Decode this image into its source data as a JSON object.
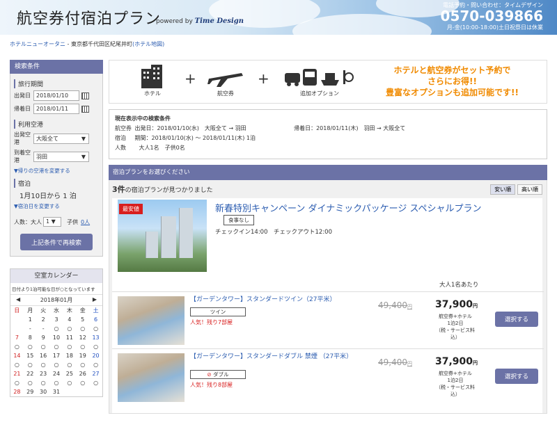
{
  "header": {
    "title": "航空券付宿泊プラン",
    "powered_by": "powered by",
    "brand": "Time Design",
    "contact_label": "電話予約・問い合わせ：タイムデザイン",
    "phone": "0570-039866",
    "hours": "月-金(10:00-18:00)土日祝祭日は休業"
  },
  "breadcrumb": {
    "hotel": "ホテルニューオータニ",
    "address": " - 東京都千代田区紀尾井町",
    "map_link": "(ホテル地図)"
  },
  "sidebar": {
    "title": "検索条件",
    "travel_period": "旅行期間",
    "depart_label": "出発日",
    "depart_value": "2018/01/10",
    "return_label": "帰着日",
    "return_value": "2018/01/11",
    "airport_title": "利用空港",
    "from_label": "出発空港",
    "from_value": "大阪全て",
    "to_label": "到着空港",
    "to_value": "羽田",
    "change_return_airport": "▼帰りの空港を変更する",
    "stay_title": "宿泊",
    "stay_text": "1月10日から 1 泊",
    "change_stay": "▼宿泊日を変更する",
    "adults_label": "人数：大人",
    "adults_value": "1",
    "children_label": "子供",
    "children_value": "0人",
    "search_button": "上記条件で再検索"
  },
  "calendar": {
    "title": "空室カレンダー",
    "note": "日付より1泊可能な日が○となっています",
    "month": "2018年01月",
    "prev": "◀",
    "next": "▶",
    "weekdays": [
      "日",
      "月",
      "火",
      "水",
      "木",
      "金",
      "土"
    ],
    "rows": [
      [
        "",
        "1",
        "2",
        "3",
        "4",
        "5",
        "6"
      ],
      [
        "",
        "-",
        "-",
        "○",
        "○",
        "○",
        "○"
      ],
      [
        "7",
        "8",
        "9",
        "10",
        "11",
        "12",
        "13"
      ],
      [
        "○",
        "○",
        "○",
        "○",
        "○",
        "○",
        "○"
      ],
      [
        "14",
        "15",
        "16",
        "17",
        "18",
        "19",
        "20"
      ],
      [
        "○",
        "○",
        "○",
        "○",
        "○",
        "○",
        "○"
      ],
      [
        "21",
        "22",
        "23",
        "24",
        "25",
        "26",
        "27"
      ],
      [
        "○",
        "○",
        "○",
        "○",
        "○",
        "○",
        "○"
      ],
      [
        "28",
        "29",
        "30",
        "31",
        "",
        "",
        ""
      ]
    ]
  },
  "banner": {
    "hotel": "ホテル",
    "flight": "航空券",
    "options": "追加オプション",
    "plus": "+",
    "promo_line1": "ホテルと航空券がセット予約で",
    "promo_line2": "さらにお得!!",
    "promo_line3": "豊富なオプションも追加可能です!!"
  },
  "conditions": {
    "title": "現在表示中の検索条件",
    "flight_label": "航空券",
    "flight_out": "出発日：2018/01/10(水)　大阪全て → 羽田",
    "flight_back": "帰着日：2018/01/11(木)　羽田 → 大阪全て",
    "stay_label": "宿泊",
    "stay_value": "期間：2018/01/10(水) 〜 2018/01/11(木) 1泊",
    "people_label": "人数",
    "people_value": "大人1名　子供0名"
  },
  "plans": {
    "header": "宿泊プランをお選びください",
    "count": "3件",
    "count_suffix": "の宿泊プランが見つかりました",
    "sort_cheap": "安い順",
    "sort_expensive": "高い順",
    "plan": {
      "badge": "最安値",
      "title": "新春特別キャンペーン ダイナミックパッケージ スペシャルプラン",
      "meal": "食事なし",
      "checkin": "チェックイン14:00　チェックアウト12:00",
      "per_person": "大人1名あたり"
    },
    "rooms": [
      {
        "name": "【ガーデンタワー】スタンダードツイン（27平米）",
        "type": "ツイン",
        "remaining": "人気！残り7部屋",
        "old_price": "49,400",
        "price": "37,900",
        "yen": "円",
        "note": "航空券+ホテル\n1泊2日\n（税・サービス料込）",
        "button": "選択する"
      },
      {
        "name": "【ガーデンタワー】スタンダードダブル 禁煙 （27平米）",
        "type": "ダブル",
        "remaining": "人気！残り8部屋",
        "old_price": "49,400",
        "price": "37,900",
        "yen": "円",
        "note": "航空券+ホテル\n1泊2日\n（税・サービス料込）",
        "button": "選択する"
      }
    ]
  },
  "colors": {
    "accent": "#6b72a6",
    "promo": "#f08a00",
    "link": "#2b5cb0",
    "alert": "#d81e1e"
  }
}
